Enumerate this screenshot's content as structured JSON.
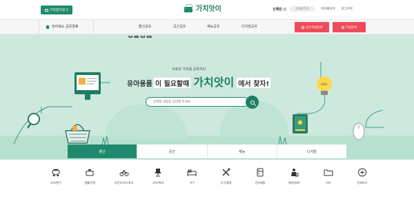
{
  "header": {
    "top_button": "가치알아보기",
    "logo_sub": "SHARE GAChI",
    "logo_main": "가치앗이",
    "user_name": "신해린",
    "user_suffix": "님",
    "points": "2580가치",
    "link_mypage": "마이페이지",
    "link_logout": "로그아웃"
  },
  "nav": {
    "region": "전라북도 공유경제",
    "items": [
      "물건공유",
      "공간공유",
      "재능공유",
      "디지털공유"
    ],
    "btn_sell": "공유자원등록",
    "btn_join": "가입등록"
  },
  "hero": {
    "cut_text": "생활용품",
    "small": "서로의 가치를 공유하다",
    "line_prefix": "유아용품",
    "line_mid": "이 필요할때",
    "brand": "가치앗이",
    "line_suffix": "에서 찾자!",
    "search_placeholder": "검색할 내용을 입력해 주세요"
  },
  "tabs": [
    "물건",
    "공간",
    "재능",
    "디지털"
  ],
  "categories": [
    {
      "label": "유아/완구",
      "icon": "baby-stroller-icon"
    },
    {
      "label": "생활/주방",
      "icon": "kitchen-pot-icon"
    },
    {
      "label": "아웃도어/스포츠",
      "icon": "outdoor-bike-icon"
    },
    {
      "label": "사무/취미",
      "icon": "office-chair-icon"
    },
    {
      "label": "가구",
      "icon": "sofa-bed-icon"
    },
    {
      "label": "공구/용품",
      "icon": "tools-icon"
    },
    {
      "label": "전자제품",
      "icon": "electronics-fridge-icon"
    },
    {
      "label": "패션/잡화",
      "icon": "fashion-bag-icon"
    },
    {
      "label": "기타",
      "icon": "folder-icon"
    },
    {
      "label": "전체보기",
      "icon": "plus-circle-icon"
    }
  ],
  "colors": {
    "primary": "#1f8a6d",
    "hero_bg": "#cde9de",
    "accent_red": "#ef4a5a"
  }
}
